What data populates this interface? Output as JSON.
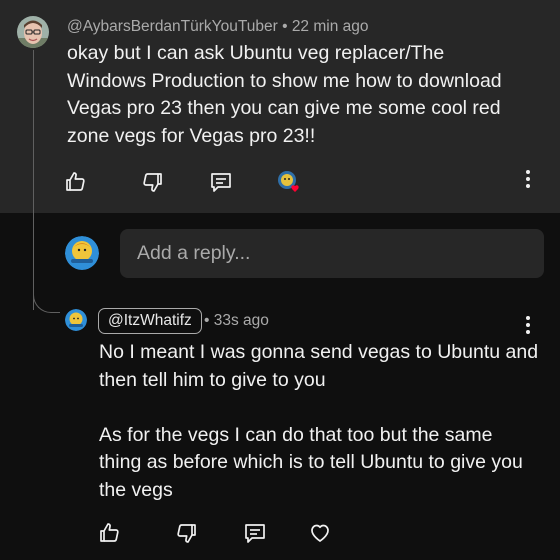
{
  "colors": {
    "top_panel_bg": "#272727",
    "page_bg": "#0f0f0f",
    "text_primary": "#f1f1f1",
    "text_secondary": "#aaaaaa",
    "heart_red": "#ff0033"
  },
  "comment": {
    "author": "@AybarsBerdanTürkYouTuber",
    "separator": "•",
    "time": "22 min ago",
    "text": "okay but I can ask Ubuntu veg replacer/The Windows Production to show me how to download Vegas pro 23 then you can give me some cool red zone vegs for Vegas pro 23!!",
    "actions": {
      "like_icon": "thumb-up-icon",
      "dislike_icon": "thumb-down-icon",
      "reply_icon": "reply-comment-icon",
      "creator_heart_icon": "creator-heart-icon"
    }
  },
  "reply_input": {
    "placeholder": "Add a reply..."
  },
  "reply": {
    "author": "@ItzWhatifz",
    "separator": "•",
    "time": "33s ago",
    "text": "No I meant I was gonna send vegas to Ubuntu and then tell him to give to you\n\nAs for the vegs I can do that too but the same thing as before which is to tell Ubuntu to give you the vegs",
    "actions": {
      "like_icon": "thumb-up-icon",
      "dislike_icon": "thumb-down-icon",
      "reply_icon": "reply-comment-icon",
      "heart_icon": "heart-icon"
    }
  }
}
